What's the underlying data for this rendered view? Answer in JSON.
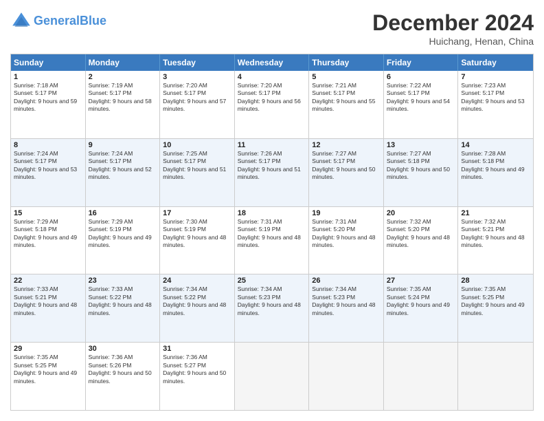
{
  "header": {
    "logo_line1": "General",
    "logo_line2": "Blue",
    "month_title": "December 2024",
    "location": "Huichang, Henan, China"
  },
  "day_names": [
    "Sunday",
    "Monday",
    "Tuesday",
    "Wednesday",
    "Thursday",
    "Friday",
    "Saturday"
  ],
  "rows": [
    {
      "alt": false,
      "cells": [
        {
          "date": "1",
          "sunrise": "Sunrise: 7:18 AM",
          "sunset": "Sunset: 5:17 PM",
          "daylight": "Daylight: 9 hours and 59 minutes."
        },
        {
          "date": "2",
          "sunrise": "Sunrise: 7:19 AM",
          "sunset": "Sunset: 5:17 PM",
          "daylight": "Daylight: 9 hours and 58 minutes."
        },
        {
          "date": "3",
          "sunrise": "Sunrise: 7:20 AM",
          "sunset": "Sunset: 5:17 PM",
          "daylight": "Daylight: 9 hours and 57 minutes."
        },
        {
          "date": "4",
          "sunrise": "Sunrise: 7:20 AM",
          "sunset": "Sunset: 5:17 PM",
          "daylight": "Daylight: 9 hours and 56 minutes."
        },
        {
          "date": "5",
          "sunrise": "Sunrise: 7:21 AM",
          "sunset": "Sunset: 5:17 PM",
          "daylight": "Daylight: 9 hours and 55 minutes."
        },
        {
          "date": "6",
          "sunrise": "Sunrise: 7:22 AM",
          "sunset": "Sunset: 5:17 PM",
          "daylight": "Daylight: 9 hours and 54 minutes."
        },
        {
          "date": "7",
          "sunrise": "Sunrise: 7:23 AM",
          "sunset": "Sunset: 5:17 PM",
          "daylight": "Daylight: 9 hours and 53 minutes."
        }
      ]
    },
    {
      "alt": true,
      "cells": [
        {
          "date": "8",
          "sunrise": "Sunrise: 7:24 AM",
          "sunset": "Sunset: 5:17 PM",
          "daylight": "Daylight: 9 hours and 53 minutes."
        },
        {
          "date": "9",
          "sunrise": "Sunrise: 7:24 AM",
          "sunset": "Sunset: 5:17 PM",
          "daylight": "Daylight: 9 hours and 52 minutes."
        },
        {
          "date": "10",
          "sunrise": "Sunrise: 7:25 AM",
          "sunset": "Sunset: 5:17 PM",
          "daylight": "Daylight: 9 hours and 51 minutes."
        },
        {
          "date": "11",
          "sunrise": "Sunrise: 7:26 AM",
          "sunset": "Sunset: 5:17 PM",
          "daylight": "Daylight: 9 hours and 51 minutes."
        },
        {
          "date": "12",
          "sunrise": "Sunrise: 7:27 AM",
          "sunset": "Sunset: 5:17 PM",
          "daylight": "Daylight: 9 hours and 50 minutes."
        },
        {
          "date": "13",
          "sunrise": "Sunrise: 7:27 AM",
          "sunset": "Sunset: 5:18 PM",
          "daylight": "Daylight: 9 hours and 50 minutes."
        },
        {
          "date": "14",
          "sunrise": "Sunrise: 7:28 AM",
          "sunset": "Sunset: 5:18 PM",
          "daylight": "Daylight: 9 hours and 49 minutes."
        }
      ]
    },
    {
      "alt": false,
      "cells": [
        {
          "date": "15",
          "sunrise": "Sunrise: 7:29 AM",
          "sunset": "Sunset: 5:18 PM",
          "daylight": "Daylight: 9 hours and 49 minutes."
        },
        {
          "date": "16",
          "sunrise": "Sunrise: 7:29 AM",
          "sunset": "Sunset: 5:19 PM",
          "daylight": "Daylight: 9 hours and 49 minutes."
        },
        {
          "date": "17",
          "sunrise": "Sunrise: 7:30 AM",
          "sunset": "Sunset: 5:19 PM",
          "daylight": "Daylight: 9 hours and 48 minutes."
        },
        {
          "date": "18",
          "sunrise": "Sunrise: 7:31 AM",
          "sunset": "Sunset: 5:19 PM",
          "daylight": "Daylight: 9 hours and 48 minutes."
        },
        {
          "date": "19",
          "sunrise": "Sunrise: 7:31 AM",
          "sunset": "Sunset: 5:20 PM",
          "daylight": "Daylight: 9 hours and 48 minutes."
        },
        {
          "date": "20",
          "sunrise": "Sunrise: 7:32 AM",
          "sunset": "Sunset: 5:20 PM",
          "daylight": "Daylight: 9 hours and 48 minutes."
        },
        {
          "date": "21",
          "sunrise": "Sunrise: 7:32 AM",
          "sunset": "Sunset: 5:21 PM",
          "daylight": "Daylight: 9 hours and 48 minutes."
        }
      ]
    },
    {
      "alt": true,
      "cells": [
        {
          "date": "22",
          "sunrise": "Sunrise: 7:33 AM",
          "sunset": "Sunset: 5:21 PM",
          "daylight": "Daylight: 9 hours and 48 minutes."
        },
        {
          "date": "23",
          "sunrise": "Sunrise: 7:33 AM",
          "sunset": "Sunset: 5:22 PM",
          "daylight": "Daylight: 9 hours and 48 minutes."
        },
        {
          "date": "24",
          "sunrise": "Sunrise: 7:34 AM",
          "sunset": "Sunset: 5:22 PM",
          "daylight": "Daylight: 9 hours and 48 minutes."
        },
        {
          "date": "25",
          "sunrise": "Sunrise: 7:34 AM",
          "sunset": "Sunset: 5:23 PM",
          "daylight": "Daylight: 9 hours and 48 minutes."
        },
        {
          "date": "26",
          "sunrise": "Sunrise: 7:34 AM",
          "sunset": "Sunset: 5:23 PM",
          "daylight": "Daylight: 9 hours and 48 minutes."
        },
        {
          "date": "27",
          "sunrise": "Sunrise: 7:35 AM",
          "sunset": "Sunset: 5:24 PM",
          "daylight": "Daylight: 9 hours and 49 minutes."
        },
        {
          "date": "28",
          "sunrise": "Sunrise: 7:35 AM",
          "sunset": "Sunset: 5:25 PM",
          "daylight": "Daylight: 9 hours and 49 minutes."
        }
      ]
    },
    {
      "alt": false,
      "cells": [
        {
          "date": "29",
          "sunrise": "Sunrise: 7:35 AM",
          "sunset": "Sunset: 5:25 PM",
          "daylight": "Daylight: 9 hours and 49 minutes."
        },
        {
          "date": "30",
          "sunrise": "Sunrise: 7:36 AM",
          "sunset": "Sunset: 5:26 PM",
          "daylight": "Daylight: 9 hours and 50 minutes."
        },
        {
          "date": "31",
          "sunrise": "Sunrise: 7:36 AM",
          "sunset": "Sunset: 5:27 PM",
          "daylight": "Daylight: 9 hours and 50 minutes."
        },
        {
          "date": "",
          "sunrise": "",
          "sunset": "",
          "daylight": ""
        },
        {
          "date": "",
          "sunrise": "",
          "sunset": "",
          "daylight": ""
        },
        {
          "date": "",
          "sunrise": "",
          "sunset": "",
          "daylight": ""
        },
        {
          "date": "",
          "sunrise": "",
          "sunset": "",
          "daylight": ""
        }
      ]
    }
  ]
}
